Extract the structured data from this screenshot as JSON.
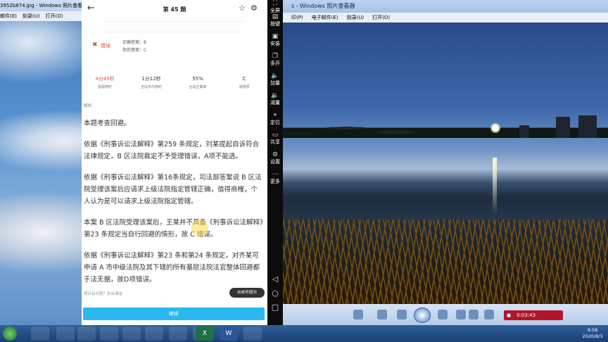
{
  "left_window": {
    "title": "3952b874.jpg - Windows 照片查看器",
    "menu": [
      "邮件(E)",
      "刻录(U)",
      "打开(O)"
    ]
  },
  "right_window": {
    "title": "s - Windows 照片查看器",
    "menu": [
      "印(P)",
      "电子邮件(E)",
      "刻录(U)",
      "打开(O)"
    ],
    "recording": {
      "time": "0:03:43"
    }
  },
  "sidebar": {
    "items": [
      {
        "icon": "⛶",
        "label": "全屏"
      },
      {
        "icon": "▤",
        "label": "按键"
      },
      {
        "icon": "▣",
        "label": "安装"
      },
      {
        "icon": "❐",
        "label": "多开"
      },
      {
        "icon": "🔈",
        "label": "加量"
      },
      {
        "icon": "🔉",
        "label": "减量"
      },
      {
        "icon": "⌖",
        "label": "定位"
      },
      {
        "icon": "▭",
        "label": "共享"
      },
      {
        "icon": "⚙",
        "label": "设置"
      },
      {
        "icon": "⋯",
        "label": "更多"
      }
    ],
    "nav": [
      "◁",
      "○",
      "□"
    ]
  },
  "app": {
    "title": "第 45 题",
    "wrong_label": "错误",
    "correct_answer": "正确答案：B",
    "your_answer": "你的答案：C",
    "stats": [
      {
        "value": "4分45秒",
        "label": "答题用时",
        "highlight": true
      },
      {
        "value": "1分12秒",
        "label": "全站平均用时",
        "highlight": false
      },
      {
        "value": "55%",
        "label": "全站正确率",
        "highlight": false
      },
      {
        "value": "C",
        "label": "易错项",
        "highlight": false
      }
    ],
    "analysis_label": "解析",
    "paragraphs": [
      "本题考查回避。",
      "依据《刑事诉讼法解释》第259 条规定，刘某提起自诉符合法律规定，B 区法院裁定不予受理错误，A项不能选。",
      "依据《刑事诉讼法解释》第16条规定，司法部答案说 B 区法院受理该案后应请求上级法院指定管辖正确，值得商榷，个人认为是可以请求上级法院指定管辖。",
      "本案 B 区法院受理该案后，王某并不具备《刑事诉讼法解释》第23 条规定当自行回避的情形，故 C 错误。",
      "依据《刑事诉讼法解释》第23 条和第24 条规定，对齐某可申请 A 市中级法院及其下辖的所有基层法院法官整体回避都于法无据，故D项错误。"
    ],
    "ask_text": "题目有问题？告诉课堂",
    "teacher_button": "向老师提问",
    "continue_button": "继续"
  },
  "taskbar": {
    "apps": [
      "",
      "",
      "",
      "",
      "",
      "",
      "",
      "",
      "X",
      "W",
      ""
    ],
    "time": "9:58",
    "date": "2020/8/3"
  }
}
